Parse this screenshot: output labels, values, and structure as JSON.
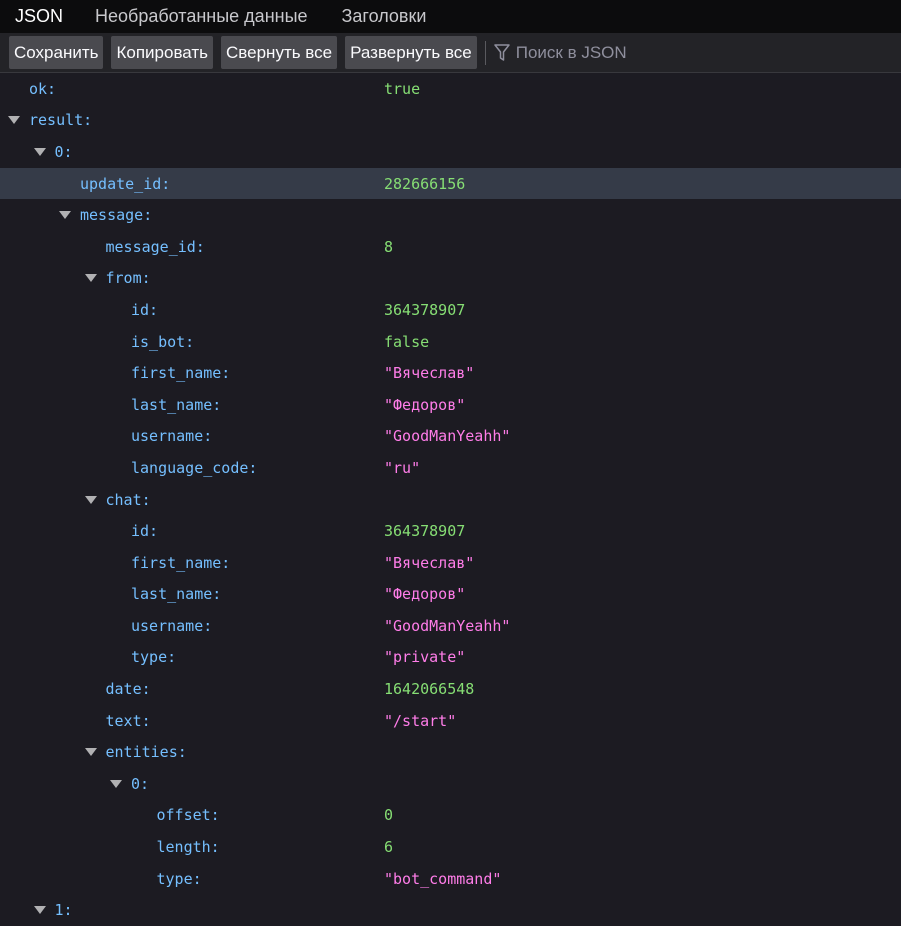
{
  "tabs": [
    "JSON",
    "Необработанные данные",
    "Заголовки"
  ],
  "toolbar": {
    "save": "Сохранить",
    "copy": "Копировать",
    "collapse": "Свернуть все",
    "expand": "Развернуть все",
    "filter_placeholder": "Поиск в JSON"
  },
  "rows": [
    {
      "key": "ok:",
      "val": "true",
      "t": "bool",
      "d": 0,
      "exp": false
    },
    {
      "key": "result:",
      "val": "",
      "t": "",
      "d": 0,
      "exp": true
    },
    {
      "key": "0:",
      "val": "",
      "t": "",
      "d": 1,
      "exp": true
    },
    {
      "key": "update_id:",
      "val": "282666156",
      "t": "num",
      "d": 2,
      "exp": false,
      "sel": true
    },
    {
      "key": "message:",
      "val": "",
      "t": "",
      "d": 2,
      "exp": true
    },
    {
      "key": "message_id:",
      "val": "8",
      "t": "num",
      "d": 3,
      "exp": false
    },
    {
      "key": "from:",
      "val": "",
      "t": "",
      "d": 3,
      "exp": true
    },
    {
      "key": "id:",
      "val": "364378907",
      "t": "num",
      "d": 4,
      "exp": false
    },
    {
      "key": "is_bot:",
      "val": "false",
      "t": "bool",
      "d": 4,
      "exp": false
    },
    {
      "key": "first_name:",
      "val": "\"Вячеслав\"",
      "t": "str",
      "d": 4,
      "exp": false
    },
    {
      "key": "last_name:",
      "val": "\"Федоров\"",
      "t": "str",
      "d": 4,
      "exp": false
    },
    {
      "key": "username:",
      "val": "\"GoodManYeahh\"",
      "t": "str",
      "d": 4,
      "exp": false
    },
    {
      "key": "language_code:",
      "val": "\"ru\"",
      "t": "str",
      "d": 4,
      "exp": false
    },
    {
      "key": "chat:",
      "val": "",
      "t": "",
      "d": 3,
      "exp": true
    },
    {
      "key": "id:",
      "val": "364378907",
      "t": "num",
      "d": 4,
      "exp": false
    },
    {
      "key": "first_name:",
      "val": "\"Вячеслав\"",
      "t": "str",
      "d": 4,
      "exp": false
    },
    {
      "key": "last_name:",
      "val": "\"Федоров\"",
      "t": "str",
      "d": 4,
      "exp": false
    },
    {
      "key": "username:",
      "val": "\"GoodManYeahh\"",
      "t": "str",
      "d": 4,
      "exp": false
    },
    {
      "key": "type:",
      "val": "\"private\"",
      "t": "str",
      "d": 4,
      "exp": false
    },
    {
      "key": "date:",
      "val": "1642066548",
      "t": "num",
      "d": 3,
      "exp": false
    },
    {
      "key": "text:",
      "val": "\"/start\"",
      "t": "str",
      "d": 3,
      "exp": false
    },
    {
      "key": "entities:",
      "val": "",
      "t": "",
      "d": 3,
      "exp": true
    },
    {
      "key": "0:",
      "val": "",
      "t": "",
      "d": 4,
      "exp": true
    },
    {
      "key": "offset:",
      "val": "0",
      "t": "num",
      "d": 5,
      "exp": false
    },
    {
      "key": "length:",
      "val": "6",
      "t": "num",
      "d": 5,
      "exp": false
    },
    {
      "key": "type:",
      "val": "\"bot_command\"",
      "t": "str",
      "d": 5,
      "exp": false
    },
    {
      "key": "1:",
      "val": "",
      "t": "",
      "d": 1,
      "exp": true
    }
  ],
  "icons": {
    "filter": "filter-icon",
    "twisty": "chevron-down-icon"
  }
}
